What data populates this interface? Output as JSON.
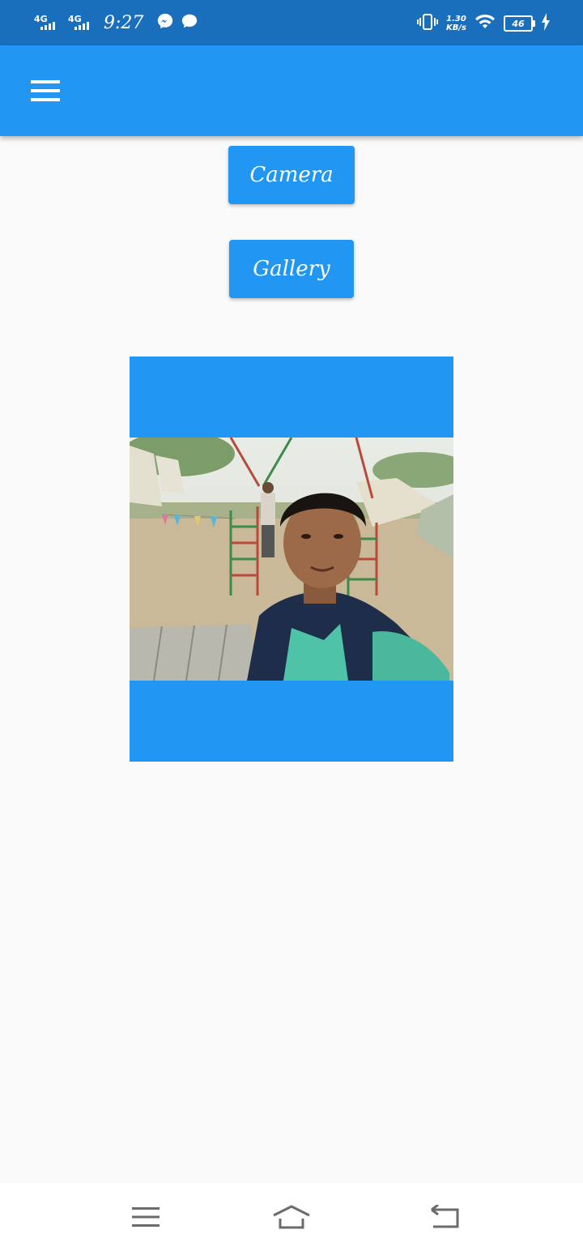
{
  "status_bar": {
    "network_1": "4G",
    "network_2": "4G",
    "time": "9:27",
    "speed_value": "1.30",
    "speed_unit": "KB/s",
    "battery": "46",
    "icons": [
      "messenger-icon",
      "chat-bubble-icon",
      "vibrate-icon",
      "wifi-icon",
      "battery-icon",
      "charging-icon"
    ]
  },
  "app_bar": {
    "color": "#2196f3",
    "menu_icon": "hamburger-menu-icon"
  },
  "buttons": {
    "camera_label": "Camera",
    "gallery_label": "Gallery"
  },
  "image": {
    "frame_color": "#2196f3",
    "description_alt": "selfie photo"
  },
  "nav_bar": {
    "icons": [
      "recent-apps-icon",
      "home-icon",
      "back-icon"
    ]
  },
  "colors": {
    "status_bar": "#1a6fbd",
    "accent": "#2196f3",
    "background": "#fafafa"
  }
}
